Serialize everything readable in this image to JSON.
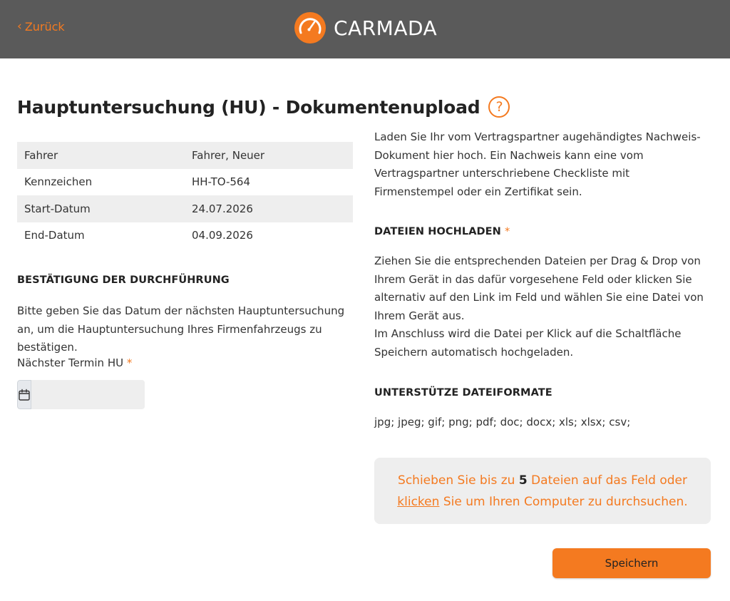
{
  "header": {
    "back_label": "Zurück",
    "logo_text": "CARMADA"
  },
  "page": {
    "title": "Hauptuntersuchung (HU) - Dokumentenupload",
    "help_symbol": "?"
  },
  "info_rows": [
    {
      "label": "Fahrer",
      "value": "Fahrer, Neuer"
    },
    {
      "label": "Kennzeichen",
      "value": "HH-TO-564"
    },
    {
      "label": "Start-Datum",
      "value": "24.07.2026"
    },
    {
      "label": "End-Datum",
      "value": "04.09.2026"
    }
  ],
  "confirmation": {
    "heading": "BESTÄTIGUNG DER DURCHFÜHRUNG",
    "text": "Bitte geben Sie das Datum der nächsten Hauptuntersuchung an, um die Hauptuntersuchung Ihres Firmenfahrzeugs zu bestätigen.",
    "field_label": "Nächster Termin HU",
    "required_mark": "*",
    "date_value": ""
  },
  "upload": {
    "intro": "Laden Sie Ihr vom Vertragspartner augehändigtes Nachweis-Dokument hier hoch. Ein Nachweis kann eine vom Vertragspartner unterschriebene Checkliste mit Firmenstempel oder ein Zertifikat sein.",
    "heading": "DATEIEN HOCHLADEN",
    "required_mark": "*",
    "instructions_1": "Ziehen Sie die entsprechenden Dateien per Drag & Drop von Ihrem Gerät in das dafür vorgesehene Feld oder klicken Sie alternativ auf den Link im Feld und wählen Sie eine Datei von Ihrem Gerät aus.",
    "instructions_2": "Im Anschluss wird die Datei per Klick auf die Schaltfläche Speichern automatisch hochgeladen.",
    "formats_heading": "UNTERSTÜTZE DATEIFORMATE",
    "formats": "jpg; jpeg; gif; png; pdf; doc; docx; xls; xlsx; csv;"
  },
  "dropzone": {
    "text_before": "Schieben Sie bis zu ",
    "count": "5",
    "text_middle": " Dateien auf das Feld oder",
    "link": "klicken",
    "text_after": " Sie um Ihren Computer zu durchsuchen."
  },
  "actions": {
    "save_label": "Speichern"
  },
  "colors": {
    "accent": "#f47a20",
    "header_bg": "#5a5a5a",
    "row_stripe": "#eeeeee"
  }
}
